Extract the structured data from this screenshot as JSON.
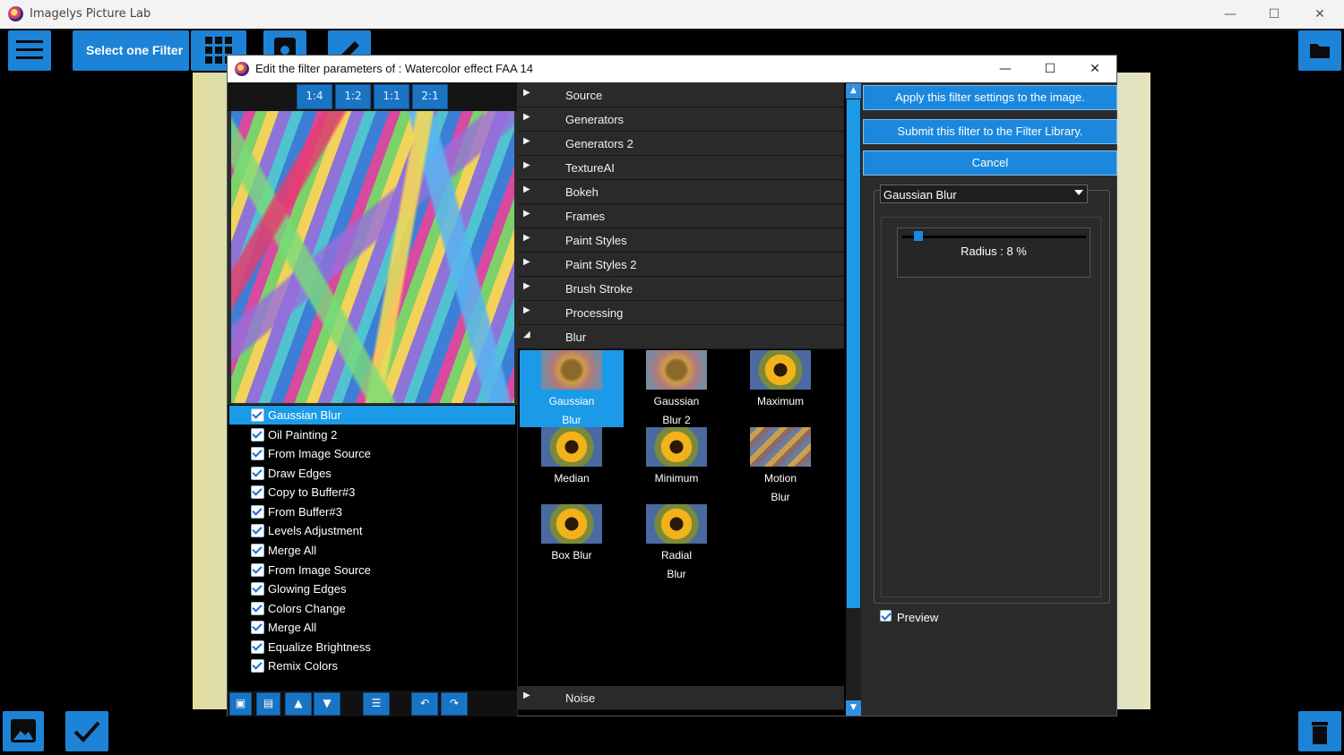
{
  "app": {
    "title": "Imagelys Picture Lab",
    "select_filter_label": "Select one Filter"
  },
  "window_controls": {
    "minimize": "—",
    "maximize": "☐",
    "close": "✕"
  },
  "dialog": {
    "title": "Edit the filter parameters of : Watercolor effect FAA 14",
    "controls": {
      "minimize": "—",
      "maximize": "☐",
      "close": "✕"
    }
  },
  "zoom": [
    "1:4",
    "1:2",
    "1:1",
    "2:1"
  ],
  "layers": [
    {
      "label": "Gaussian Blur",
      "checked": true,
      "selected": true
    },
    {
      "label": "Oil Painting 2",
      "checked": true
    },
    {
      "label": "From Image Source",
      "checked": true
    },
    {
      "label": "Draw Edges",
      "checked": true
    },
    {
      "label": "Copy to Buffer#3",
      "checked": true
    },
    {
      "label": "From Buffer#3",
      "checked": true
    },
    {
      "label": "Levels Adjustment",
      "checked": true
    },
    {
      "label": "Merge All",
      "checked": true
    },
    {
      "label": "From Image Source",
      "checked": true
    },
    {
      "label": "Glowing Edges",
      "checked": true
    },
    {
      "label": "Colors Change",
      "checked": true
    },
    {
      "label": "Merge All",
      "checked": true
    },
    {
      "label": "Equalize Brightness",
      "checked": true
    },
    {
      "label": "Remix Colors",
      "checked": true
    }
  ],
  "categories": [
    "Source",
    "Generators",
    "Generators 2",
    "TextureAI",
    "Bokeh",
    "Frames",
    "Paint Styles",
    "Paint Styles 2",
    "Brush Stroke",
    "Processing",
    "Blur"
  ],
  "category_arrows": {
    "collapsed": "▶",
    "expanded": "◢"
  },
  "blur_filters": [
    {
      "line1": "Gaussian",
      "line2": "Blur",
      "selected": true
    },
    {
      "line1": "Gaussian",
      "line2": "Blur 2"
    },
    {
      "line1": "Maximum",
      "line2": ""
    },
    {
      "line1": "Median",
      "line2": ""
    },
    {
      "line1": "Minimum",
      "line2": ""
    },
    {
      "line1": "Motion",
      "line2": "Blur"
    },
    {
      "line1": "Box Blur",
      "line2": ""
    },
    {
      "line1": "Radial",
      "line2": "Blur"
    }
  ],
  "noise_category": "Noise",
  "actions": {
    "apply": "Apply this filter settings to the image.",
    "submit": "Submit this filter to the Filter Library.",
    "cancel": "Cancel"
  },
  "filter_params": {
    "selected_filter": "Gaussian Blur",
    "radius_label": "Radius : 8 %",
    "radius_value": 8,
    "preview_label": "Preview",
    "preview_checked": true
  },
  "colors": {
    "accent": "#1b88dd",
    "selection": "#1b9ae8",
    "toolbar_blue": "#1d83d6"
  }
}
